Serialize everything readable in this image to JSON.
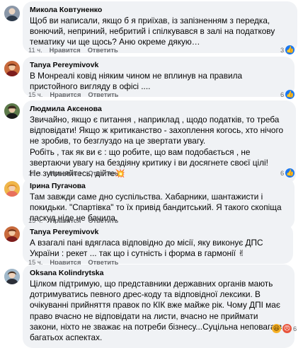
{
  "actions": {
    "like": "Нравится",
    "reply": "Ответить"
  },
  "comments": [
    {
      "author": "Микола Ковтуненко",
      "text": "Щоб ви написали, якщо б я приїхав, із запізненням з передка, вонючий, неприний, небритий і спілкувався в залі на податкову тематику чи ще щось? Аню окреме дякую…",
      "time": "11 ч.",
      "reactions_count": "3",
      "reaction_icon": "like-icon"
    },
    {
      "author": "Tanya Pereymivovk",
      "text": "В Монреалі ковід ніяким чином не вплинув на правила пристойного вигляду в офісі ....",
      "time": "15 ч.",
      "reactions_count": "6",
      "reaction_icon": "like-icon"
    },
    {
      "author": "Людмила Аксенова",
      "text": "Звичайно, якщо є питання , наприклад , щодо податків, то треба відповідати! Якщо ж критиканство - захоплення когось, хто нічого не зробив, то безглуздо на це звертати увагу.\nРобіть , так як ви є : що робите, що вам подобається , не звертаючи увагу на бездіяну критику і ви досягнете своєї цілі!\nНе зупиняйтесь, дійте💥",
      "time": "15 ч.",
      "reactions_count": "6",
      "reaction_icon": "like-icon"
    },
    {
      "author": "Ірина Пугачова",
      "text": "Там завжди саме дно суспільства. Хабарники, шантажисти і покидьки. \"Спартівка\" то їх привід бандитський. Я такого скопіща паскуд ніде не бачила.",
      "time": "15 ч.",
      "reactions_count": "",
      "reaction_icon": ""
    },
    {
      "author": "Tanya Pereymivovk",
      "text": "А взагалі пані вдягласа відповідно до місії, яку виконує ДПС України : рекет ... так що і сутність і форма в гармонії ✌",
      "time": "15 ч.",
      "reactions_count": "",
      "reaction_icon": ""
    },
    {
      "author": "Oksana Kolindrytska",
      "text": "Цілком підтримую, що представники державних органів мають дотримуватись певного дрес-коду та відповідної лексики. В очікуванні прийняття правок по КІК вже майже рік. Чому ДПІ має право вчасно не відповідати на листи, вчасно не приймати закони, ніхто не зважає на потреби бізнесу...Суцільна неповага в багатьох аспектах.",
      "time": "",
      "reactions_count": "6",
      "reaction_icon": "haha-angry-icon"
    }
  ]
}
